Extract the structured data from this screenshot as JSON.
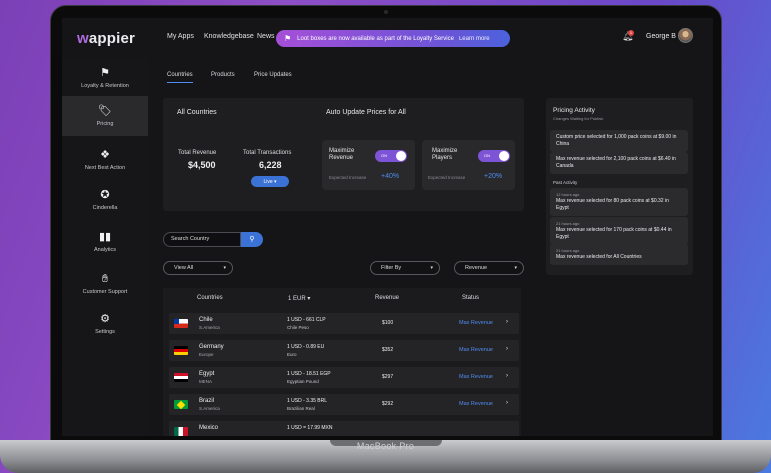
{
  "header": {
    "logo_prefix": "w",
    "logo_rest": "appier",
    "nav": [
      "My Apps",
      "Knowledgebase",
      "News"
    ],
    "promo_text": "Loot boxes are now available as part of the Loyalty Service",
    "promo_link": "Learn more",
    "notification_count": "1",
    "user_name": "George B"
  },
  "sidebar": {
    "items": [
      {
        "label": "Loyalty & Retention",
        "icon": "flag-icon"
      },
      {
        "label": "Pricing",
        "icon": "tag-icon"
      },
      {
        "label": "Next Best Action",
        "icon": "network-icon"
      },
      {
        "label": "Cinderella",
        "icon": "crown-icon"
      },
      {
        "label": "Analytics",
        "icon": "bar-chart-icon"
      },
      {
        "label": "Customer Support",
        "icon": "hand-icon"
      },
      {
        "label": "Settings",
        "icon": "gear-icon"
      }
    ],
    "active": "Pricing"
  },
  "tabs": [
    "Countries",
    "Products",
    "Price Updates"
  ],
  "summary": {
    "title": "All Countries",
    "auto_update_title": "Auto Update Prices for All",
    "total_revenue_label": "Total Revenue",
    "total_revenue": "$4,500",
    "total_transactions_label": "Total Transactions",
    "total_transactions": "6,228",
    "live_label": "Live",
    "maximize_revenue_label": "Maximize Revenue",
    "maximize_players_label": "Maximize Players",
    "toggle_on": "ON",
    "expected_revenue_label": "Expected Increase",
    "expected_revenue_value": "+40%",
    "expected_players_label": "Expected Increase",
    "expected_players_value": "+20%"
  },
  "search": {
    "placeholder": "Search Country"
  },
  "filters": {
    "view": "View All",
    "filter": "Filter By",
    "sort": "Revenue"
  },
  "table": {
    "headers": [
      "Countries",
      "1 EUR",
      "Revenue",
      "Status"
    ],
    "rows": [
      {
        "name": "Chile",
        "region": "S.America",
        "rate": "1 USD - 661 CLP",
        "currency": "Chile Peso",
        "revenue": "$100",
        "status": "Max Revenue"
      },
      {
        "name": "Germany",
        "region": "Europe",
        "rate": "1 USD - 0.89 EU",
        "currency": "Euro",
        "revenue": "$352",
        "status": "Max Revenue"
      },
      {
        "name": "Egypt",
        "region": "MENA",
        "rate": "1 USD - 18.51 EGP",
        "currency": "Egyptian Pound",
        "revenue": "$297",
        "status": "Max Revenue"
      },
      {
        "name": "Brazil",
        "region": "S.America",
        "rate": "1 USD - 3.35 BRL",
        "currency": "Brazilian Real",
        "revenue": "$292",
        "status": "Max Revenue"
      },
      {
        "name": "Mexico",
        "region": "",
        "rate": "1 USD = 17.99 MXN",
        "currency": "",
        "revenue": "",
        "status": ""
      }
    ]
  },
  "activity": {
    "title": "Pricing Activity",
    "subtitle": "Changes Waiting for Publish",
    "pending": [
      "Custom price selected for 1,000 pack coins at $9.00 in China",
      "Max revenue selected for 2,100 pack coins at $6.40 in Canada"
    ],
    "past_title": "Past Activity",
    "past": [
      {
        "time": "12 hours ago",
        "text": "Max revenue selected for 80 pack coins at $0.32 in Egypt"
      },
      {
        "time": "21 hours ago",
        "text": "Max revenue selected for 170 pack coins at $0.44 in Egypt"
      },
      {
        "time": "21 hours ago",
        "text": "Max revenue selected for All Countries"
      }
    ]
  },
  "device_label": "MacBook Pro",
  "colors": {
    "accent": "#3b72d6",
    "status": "#4f8df0",
    "toggle": "#7d54d6",
    "brand": "#b06be0"
  }
}
